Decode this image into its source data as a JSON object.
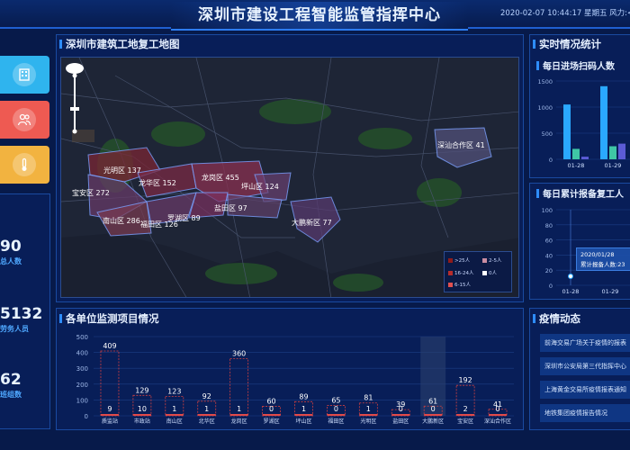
{
  "header": {
    "title": "深圳市建设工程智能监管指挥中心",
    "time": "2020-02-07 10:44:17   星期五   风力:<"
  },
  "colors": {
    "accent": "#2e8dff",
    "bar_blue": "#2aa8ff",
    "bar_green": "#3fc6a5",
    "bar_red": "#e04a4a",
    "background": "#071a4a"
  },
  "nav": [
    {
      "name": "building",
      "icon": "building-icon",
      "color": "#2fb4ee"
    },
    {
      "name": "people",
      "icon": "people-icon",
      "color": "#ee5a52"
    },
    {
      "name": "thermometer",
      "icon": "thermometer-icon",
      "color": "#f2b340"
    }
  ],
  "stats": [
    {
      "value": "90",
      "label": "总人数"
    },
    {
      "value": "5132",
      "label": "劳务人员"
    },
    {
      "value": "62",
      "label": "班组数"
    }
  ],
  "map_panel": {
    "title": "深圳市建筑工地复工地图",
    "districts": [
      {
        "label": "光明区 137"
      },
      {
        "label": "宝安区 272"
      },
      {
        "label": "龙华区 152"
      },
      {
        "label": "龙岗区 455"
      },
      {
        "label": "坪山区 124"
      },
      {
        "label": "南山区 286"
      },
      {
        "label": "福田区 126"
      },
      {
        "label": "罗湖区 89"
      },
      {
        "label": "盐田区 97"
      },
      {
        "label": "大鹏新区 77"
      },
      {
        "label": "深汕合作区 41"
      }
    ],
    "legend": [
      {
        "label": ">25人",
        "color": "#8f1b1b"
      },
      {
        "label": "2-5人",
        "color": "#c98da2"
      },
      {
        "label": "16-24人",
        "color": "#b72c2c"
      },
      {
        "label": "0人",
        "color": "#ffffff"
      },
      {
        "label": "6-15人",
        "color": "#e05050"
      }
    ]
  },
  "monitor_panel": {
    "title": "各单位监测项目情况",
    "chart_data": {
      "type": "bar",
      "categories": [
        "质监站",
        "市政站",
        "南山区",
        "北华区",
        "龙岗区",
        "罗湖区",
        "坪山区",
        "福田区",
        "光明区",
        "盐田区",
        "大鹏新区",
        "宝安区",
        "深汕合作区"
      ],
      "series": [
        {
          "values": [
            409,
            129,
            123,
            92,
            360,
            60,
            89,
            65,
            81,
            39,
            61,
            192,
            41
          ]
        },
        {
          "values": [
            9,
            10,
            1,
            1,
            1,
            0,
            1,
            0,
            1,
            0,
            0,
            2,
            0
          ]
        }
      ],
      "yticks": [
        "500",
        "400",
        "300",
        "200",
        "100",
        "0"
      ],
      "ylim": [
        0,
        500
      ]
    }
  },
  "realtime": {
    "title": "实时情况统计",
    "scan_chart": {
      "title": "每日进场扫码人数",
      "chart_data": {
        "type": "bar",
        "categories": [
          "01-28",
          "01-29"
        ],
        "series": [
          {
            "values": [
              1050,
              200,
              50
            ]
          },
          {
            "values": [
              1400,
              250,
              300
            ]
          }
        ],
        "yticks": [
          "1500",
          "1000",
          "500",
          "0"
        ],
        "ylim": [
          0,
          1500
        ]
      }
    },
    "report_chart": {
      "title": "每日累计报备复工人",
      "chart_data": {
        "type": "line",
        "x": [
          "01-28",
          "01-29"
        ],
        "yticks": [
          "100",
          "80",
          "60",
          "40",
          "20",
          "0"
        ],
        "ylim": [
          0,
          100
        ],
        "values": [
          0,
          0
        ]
      },
      "tooltip_date": "2020/01/28",
      "tooltip_text": "累计报备人数:23"
    },
    "epidemic": {
      "title": "疫情动态",
      "items": [
        "前海交易广场关于疫情的报表",
        "深圳市公安局第三代指挥中心",
        "上海黄金交易所疫情报表通知",
        "地铁集团疫情报告情况"
      ]
    }
  }
}
